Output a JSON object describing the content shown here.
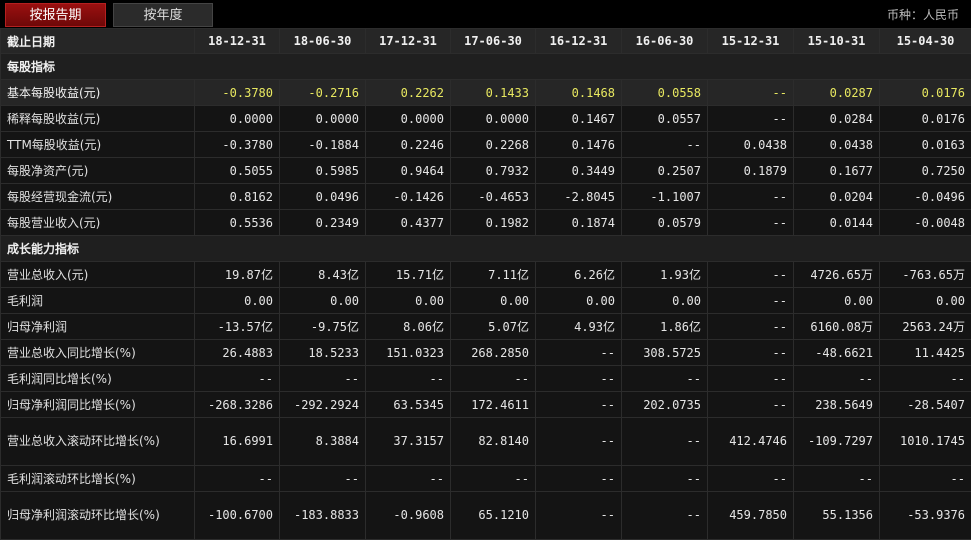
{
  "tabs": {
    "by_period": "按报告期",
    "by_year": "按年度"
  },
  "currency_label": "币种：人民币",
  "header": {
    "first": "截止日期",
    "dates": [
      "18-12-31",
      "18-06-30",
      "17-12-31",
      "17-06-30",
      "16-12-31",
      "16-06-30",
      "15-12-31",
      "15-10-31",
      "15-04-30"
    ]
  },
  "sections": [
    {
      "title": "每股指标",
      "rows": [
        {
          "label": "基本每股收益(元)",
          "highlight": true,
          "values": [
            "-0.3780",
            "-0.2716",
            "0.2262",
            "0.1433",
            "0.1468",
            "0.0558",
            "--",
            "0.0287",
            "0.0176"
          ]
        },
        {
          "label": "稀释每股收益(元)",
          "values": [
            "0.0000",
            "0.0000",
            "0.0000",
            "0.0000",
            "0.1467",
            "0.0557",
            "--",
            "0.0284",
            "0.0176"
          ]
        },
        {
          "label": "TTM每股收益(元)",
          "values": [
            "-0.3780",
            "-0.1884",
            "0.2246",
            "0.2268",
            "0.1476",
            "--",
            "0.0438",
            "0.0438",
            "0.0163"
          ]
        },
        {
          "label": "每股净资产(元)",
          "values": [
            "0.5055",
            "0.5985",
            "0.9464",
            "0.7932",
            "0.3449",
            "0.2507",
            "0.1879",
            "0.1677",
            "0.7250"
          ]
        },
        {
          "label": "每股经营现金流(元)",
          "values": [
            "0.8162",
            "0.0496",
            "-0.1426",
            "-0.4653",
            "-2.8045",
            "-1.1007",
            "--",
            "0.0204",
            "-0.0496"
          ]
        },
        {
          "label": "每股营业收入(元)",
          "values": [
            "0.5536",
            "0.2349",
            "0.4377",
            "0.1982",
            "0.1874",
            "0.0579",
            "--",
            "0.0144",
            "-0.0048"
          ]
        }
      ]
    },
    {
      "title": "成长能力指标",
      "rows": [
        {
          "label": "营业总收入(元)",
          "values": [
            "19.87亿",
            "8.43亿",
            "15.71亿",
            "7.11亿",
            "6.26亿",
            "1.93亿",
            "--",
            "4726.65万",
            "-763.65万"
          ]
        },
        {
          "label": "毛利润",
          "values": [
            "0.00",
            "0.00",
            "0.00",
            "0.00",
            "0.00",
            "0.00",
            "--",
            "0.00",
            "0.00"
          ]
        },
        {
          "label": "归母净利润",
          "values": [
            "-13.57亿",
            "-9.75亿",
            "8.06亿",
            "5.07亿",
            "4.93亿",
            "1.86亿",
            "--",
            "6160.08万",
            "2563.24万"
          ]
        },
        {
          "label": "营业总收入同比增长(%)",
          "values": [
            "26.4883",
            "18.5233",
            "151.0323",
            "268.2850",
            "--",
            "308.5725",
            "--",
            "-48.6621",
            "11.4425"
          ]
        },
        {
          "label": "毛利润同比增长(%)",
          "values": [
            "--",
            "--",
            "--",
            "--",
            "--",
            "--",
            "--",
            "--",
            "--"
          ]
        },
        {
          "label": "归母净利润同比增长(%)",
          "values": [
            "-268.3286",
            "-292.2924",
            "63.5345",
            "172.4611",
            "--",
            "202.0735",
            "--",
            "238.5649",
            "-28.5407"
          ]
        },
        {
          "label": "营业总收入滚动环比增长(%)",
          "tall": true,
          "values": [
            "16.6991",
            "8.3884",
            "37.3157",
            "82.8140",
            "--",
            "--",
            "412.4746",
            "-109.7297",
            "1010.1745"
          ]
        },
        {
          "label": "毛利润滚动环比增长(%)",
          "values": [
            "--",
            "--",
            "--",
            "--",
            "--",
            "--",
            "--",
            "--",
            "--"
          ]
        },
        {
          "label": "归母净利润滚动环比增长(%)",
          "tall": true,
          "values": [
            "-100.6700",
            "-183.8833",
            "-0.9608",
            "65.1210",
            "--",
            "--",
            "459.7850",
            "55.1356",
            "-53.9376"
          ]
        }
      ]
    }
  ]
}
